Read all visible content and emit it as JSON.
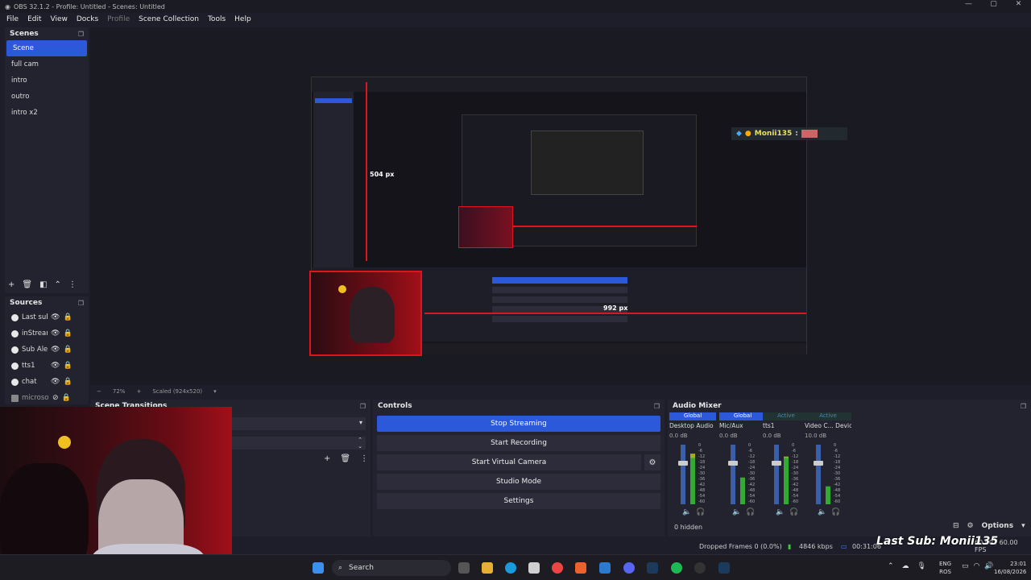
{
  "window": {
    "title": "OBS 32.1.2 - Profile: Untitled - Scenes: Untitled"
  },
  "menu": [
    "File",
    "Edit",
    "View",
    "Docks",
    "Profile",
    "Scene Collection",
    "Tools",
    "Help"
  ],
  "scenes": {
    "title": "Scenes",
    "items": [
      "Scene",
      "full cam",
      "intro",
      "outro",
      "intro x2"
    ]
  },
  "sources": {
    "title": "Sources",
    "items": [
      "Last sub",
      "inStream",
      "Sub Alert",
      "tts1",
      "chat",
      "microsoft"
    ]
  },
  "preview": {
    "px_label_vertical": "504 px",
    "px_label_horizontal": "992 px",
    "overlay_user": "Monii135",
    "zoom": "72%",
    "scaled": "Scaled (924x520)"
  },
  "transitions": {
    "title": "Scene Transitions"
  },
  "controls": {
    "title": "Controls",
    "stop_streaming": "Stop Streaming",
    "start_recording": "Start Recording",
    "start_virtual_camera": "Start Virtual Camera",
    "studio_mode": "Studio Mode",
    "settings": "Settings"
  },
  "mixer": {
    "title": "Audio Mixer",
    "channels": [
      {
        "tag": "Global",
        "name": "Desktop Audio",
        "db": "0.0 dB",
        "level": 0.7,
        "meter_level": 0.85
      },
      {
        "tag": "Global",
        "name": "Mic/Aux",
        "db": "0.0 dB",
        "level": 0.7,
        "meter_level": 0.45
      },
      {
        "tag": "Active",
        "name": "tts1",
        "db": "0.0 dB",
        "level": 0.7,
        "meter_level": 0.8
      },
      {
        "tag": "Active",
        "name": "Video C... Device",
        "db": "10.0 dB",
        "level": 0.7,
        "meter_level": 0.3
      }
    ],
    "scale": [
      "0",
      "-6",
      "-12",
      "-18",
      "-24",
      "-30",
      "-36",
      "-42",
      "-48",
      "-54",
      "-60"
    ],
    "hidden": "0 hidden",
    "options": "Options"
  },
  "status": {
    "dropped": "Dropped Frames 0 (0.0%)",
    "kbps": "4846 kbps",
    "time": "00:31:06",
    "fps": "60.00 / 60.00 FPS"
  },
  "overlay": {
    "last_sub": "Last Sub: Monii135"
  },
  "taskbar": {
    "search": "Search",
    "lang": "ENG",
    "region": "ROS",
    "clock": "23:01",
    "date": "16/08/2026"
  },
  "colors": {
    "accent": "#2b59d9",
    "panel": "#232330",
    "bg": "#1e1e2a",
    "red_guide": "#e0141e"
  }
}
